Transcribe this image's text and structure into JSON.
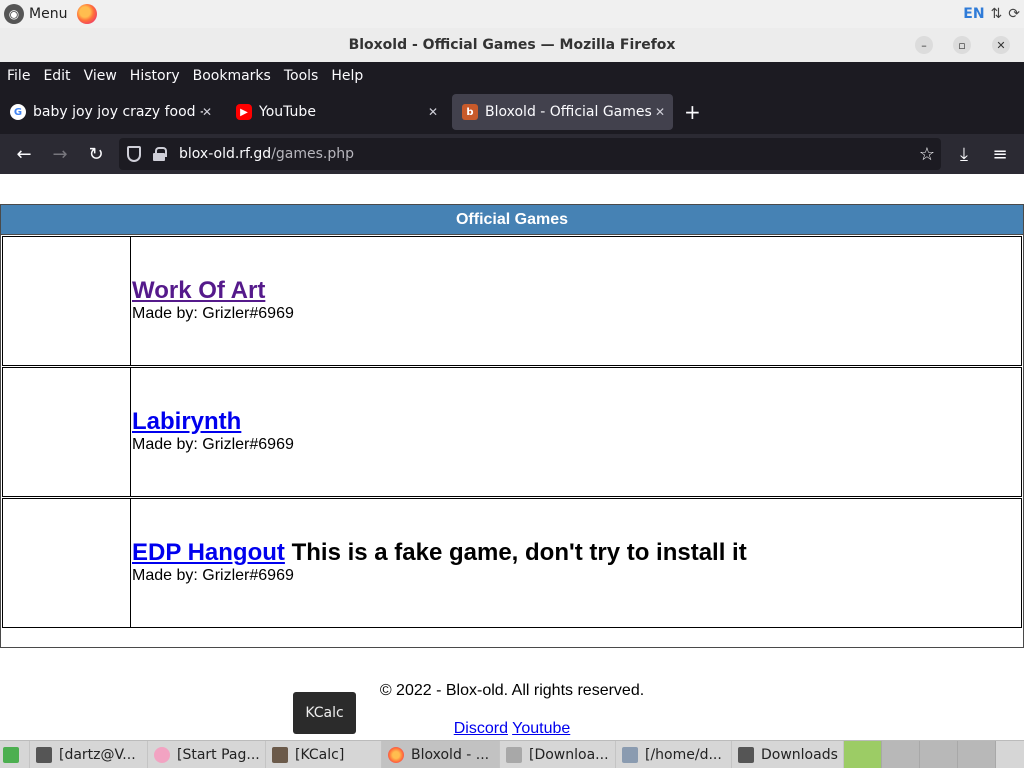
{
  "system_panel": {
    "menu_label": "Menu",
    "language": "EN"
  },
  "window": {
    "title": "Bloxold - Official Games — Mozilla Firefox",
    "minimize": "–",
    "maximize": "▫",
    "close": "✕"
  },
  "menubar": {
    "items": [
      "File",
      "Edit",
      "View",
      "History",
      "Bookmarks",
      "Tools",
      "Help"
    ]
  },
  "tabs": [
    {
      "label": "baby joy joy crazy food - G",
      "icon": "google-icon",
      "close": "✕"
    },
    {
      "label": "YouTube",
      "icon": "youtube-icon",
      "close": "✕"
    },
    {
      "label": "Bloxold - Official Games",
      "icon": "bloxold-icon",
      "close": "✕",
      "active": true
    }
  ],
  "new_tab": "+",
  "navbar": {
    "back": "←",
    "forward": "→",
    "reload": "↻",
    "url_host": "blox-old.rf.gd",
    "url_path": "/games.php",
    "bookmark_star": "☆",
    "download": "⤓",
    "menu": "≡"
  },
  "page": {
    "header": "Official Games",
    "games": [
      {
        "title": "Work Of Art",
        "note": "",
        "maker": "Made by: Grizler#6969",
        "visited": true
      },
      {
        "title": "Labirynth",
        "note": "",
        "maker": "Made by: Grizler#6969",
        "visited": false
      },
      {
        "title": "EDP Hangout",
        "note": " This is a fake game, don't try to install it",
        "maker": "Made by: Grizler#6969",
        "visited": false
      }
    ],
    "footer": "© 2022 - Blox-old. All rights reserved.",
    "links": [
      "Discord",
      "Youtube"
    ]
  },
  "tooltip": "KCalc",
  "taskbar": {
    "items": [
      {
        "label": "[dartz@V...",
        "icon": "terminal-icon"
      },
      {
        "label": "[Start Pag...",
        "icon": "browser-icon"
      },
      {
        "label": "[KCalc]",
        "icon": "calculator-icon"
      },
      {
        "label": "Bloxold - ...",
        "icon": "firefox-icon"
      },
      {
        "label": "[Downloa...",
        "icon": "folder-icon"
      },
      {
        "label": "[/home/d...",
        "icon": "image-viewer-icon"
      },
      {
        "label": "Downloads",
        "icon": "folder-icon"
      }
    ]
  },
  "colors": {
    "header_bg": "#4682b4",
    "link": "#0000ee",
    "visited_link": "#551a8b",
    "firefox_dark": "#1c1b22"
  }
}
